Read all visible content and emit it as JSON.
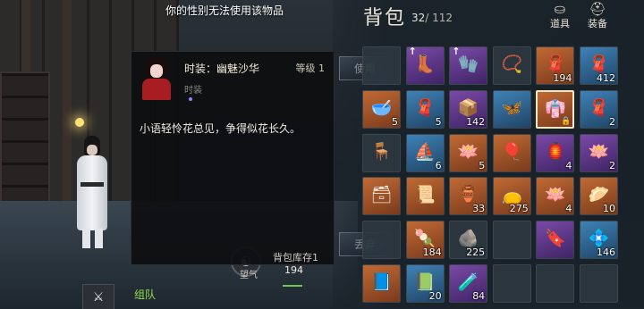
{
  "notice": "你的性别无法使用该物品",
  "tooltip": {
    "name": "时装：幽魅沙华",
    "level": "等级 1",
    "category": "时装",
    "description": "小语轻怜花总见，争得似花长久。",
    "stock_label": "背包库存1",
    "stock_value": "194",
    "qi_label": "望气",
    "use_button": "使用",
    "discard_button": "丢弃"
  },
  "team_label": "组队",
  "bag": {
    "title": "背包",
    "used": "32",
    "capacity": "/ 112",
    "tabs": [
      {
        "label": "道具",
        "icon": "bag-icon"
      },
      {
        "label": "装备",
        "icon": "helmet-icon"
      }
    ],
    "slots": [
      {
        "quality": "empty",
        "icon": "",
        "count": ""
      },
      {
        "quality": "q-purple",
        "icon": "boots-icon",
        "count": "",
        "up": true
      },
      {
        "quality": "q-purple",
        "icon": "gauntlet-icon",
        "count": "",
        "up": true
      },
      {
        "quality": "empty",
        "icon": "necklace-icon",
        "count": ""
      },
      {
        "quality": "q-orange",
        "icon": "cloth-icon",
        "count": "194"
      },
      {
        "quality": "q-blue",
        "icon": "cloth-icon",
        "count": "412"
      },
      {
        "quality": "q-orange",
        "icon": "bowl-icon",
        "count": "5"
      },
      {
        "quality": "q-blue",
        "icon": "cloth-icon",
        "count": "5"
      },
      {
        "quality": "q-purple",
        "icon": "chest-icon",
        "count": "142"
      },
      {
        "quality": "q-blue",
        "icon": "butterfly-icon",
        "count": ""
      },
      {
        "quality": "q-orange",
        "icon": "portrait-icon",
        "count": "",
        "selected": true,
        "lock": true
      },
      {
        "quality": "q-blue",
        "icon": "cloth-icon",
        "count": "2"
      },
      {
        "quality": "empty",
        "icon": "chair-icon",
        "count": ""
      },
      {
        "quality": "q-blue",
        "icon": "boat-icon",
        "count": "6"
      },
      {
        "quality": "q-orange",
        "icon": "lotus-icon",
        "count": "5"
      },
      {
        "quality": "q-orange",
        "icon": "balloon-icon",
        "count": ""
      },
      {
        "quality": "q-purple",
        "icon": "lantern-table-icon",
        "count": "4"
      },
      {
        "quality": "q-purple",
        "icon": "lotus-icon",
        "count": "2"
      },
      {
        "quality": "q-orange",
        "icon": "box-icon",
        "count": ""
      },
      {
        "quality": "q-orange",
        "icon": "scroll-icon",
        "count": ""
      },
      {
        "quality": "q-orange",
        "icon": "vase-icon",
        "count": "33"
      },
      {
        "quality": "q-orange",
        "icon": "pouch-icon",
        "count": "275"
      },
      {
        "quality": "q-orange",
        "icon": "lotus-icon",
        "count": "4"
      },
      {
        "quality": "q-orange",
        "icon": "bun-icon",
        "count": "10"
      },
      {
        "quality": "empty",
        "icon": "",
        "count": ""
      },
      {
        "quality": "q-orange",
        "icon": "food-icon",
        "count": "184"
      },
      {
        "quality": "empty",
        "icon": "ore-icon",
        "count": "225"
      },
      {
        "quality": "empty",
        "icon": "",
        "count": ""
      },
      {
        "quality": "q-purple",
        "icon": "talisman-icon",
        "count": ""
      },
      {
        "quality": "q-blue",
        "icon": "jade-icon",
        "count": "146"
      },
      {
        "quality": "q-orange",
        "icon": "book-icon",
        "count": ""
      },
      {
        "quality": "q-blue",
        "icon": "seal-icon",
        "count": "20"
      },
      {
        "quality": "q-purple",
        "icon": "bottle-icon",
        "count": "84"
      },
      {
        "quality": "empty",
        "icon": "",
        "count": ""
      },
      {
        "quality": "empty",
        "icon": "",
        "count": ""
      },
      {
        "quality": "empty",
        "icon": "",
        "count": ""
      }
    ]
  }
}
